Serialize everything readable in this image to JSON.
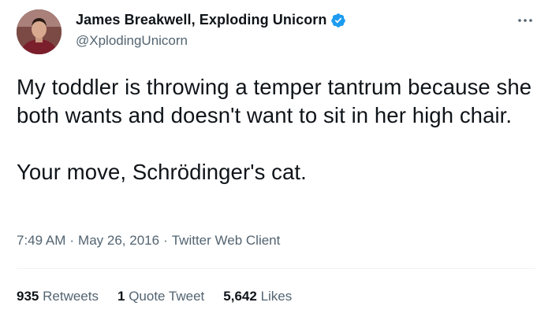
{
  "author": {
    "display_name": "James Breakwell, Exploding Unicorn",
    "handle": "@XplodingUnicorn",
    "verified": true,
    "avatar_icon": "profile-photo",
    "verified_icon": "verified-badge-icon",
    "verified_color": "#1d9bf0"
  },
  "tweet": {
    "paragraph_1": "My toddler is throwing a temper tantrum because she both wants and doesn't want to sit in her high chair.",
    "paragraph_2": "Your move, Schrödinger's cat.",
    "time": "7:49 AM",
    "date": "May 26, 2016",
    "client": "Twitter Web Client",
    "separator": "·"
  },
  "stats": {
    "retweets_count": "935",
    "retweets_label": "Retweets",
    "quotes_count": "1",
    "quotes_label": "Quote Tweet",
    "likes_count": "5,642",
    "likes_label": "Likes"
  },
  "more_icon": "more-options-icon"
}
